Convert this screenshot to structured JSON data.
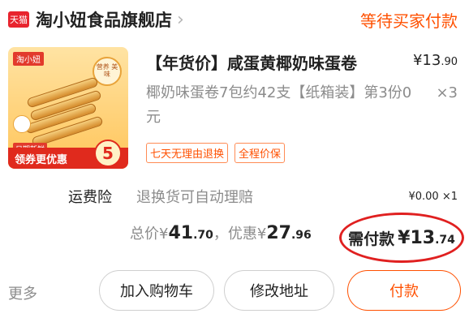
{
  "store": {
    "badge": "天猫",
    "name": "淘小妞食品旗舰店",
    "status": "等待买家付款"
  },
  "product": {
    "title": "【年货价】咸蛋黄椰奶味蛋卷",
    "sku": "椰奶味蛋卷7包约42支【纸箱装】第3份0元",
    "price_yuan": "13",
    "price_cents": ".90",
    "qty": "×3",
    "tags": [
      "七天无理由退换",
      "全程价保"
    ],
    "thumbnail": {
      "brand": "淘小妞",
      "seal": "营养 美味",
      "date": "日期新鲜",
      "promo": "领券更优惠",
      "price": "5"
    }
  },
  "insurance": {
    "label": "运费险",
    "desc": "退换货可自动理赔",
    "price": "¥0.00 ×1"
  },
  "totals": {
    "total_label": "总价",
    "currency": "¥",
    "total_yuan": "41",
    "total_cents": ".70",
    "sep": "，",
    "discount_label": "优惠",
    "discount_yuan": "27",
    "discount_cents": ".96",
    "due_label": "需付款",
    "due_yuan": "13",
    "due_cents": ".74"
  },
  "actions": {
    "more": "更多",
    "cart": "加入购物车",
    "address": "修改地址",
    "pay": "付款"
  },
  "colors": {
    "accent": "#ff5000",
    "tmall_red": "#e8242e",
    "highlight_circle": "#e02020"
  }
}
